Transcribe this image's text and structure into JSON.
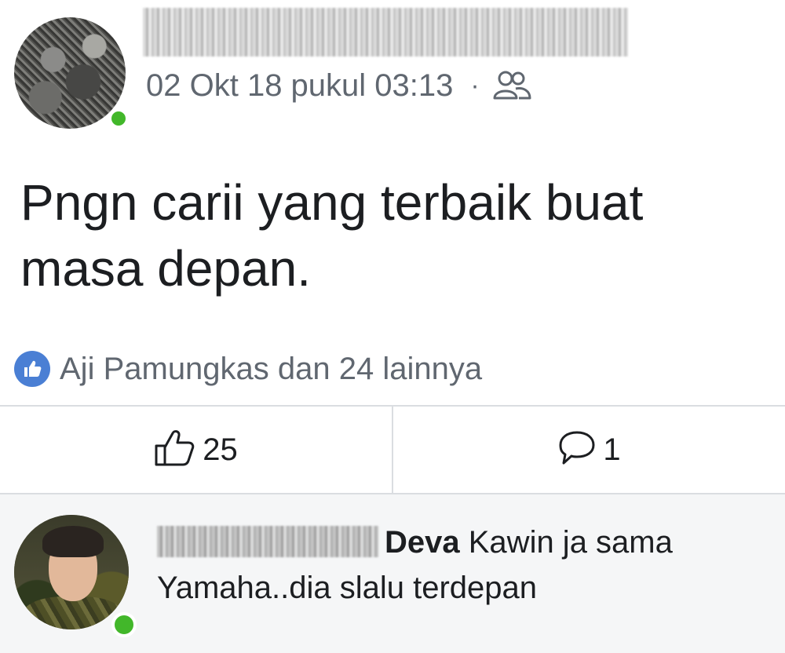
{
  "post": {
    "author_name": "",
    "timestamp": "02 Okt 18 pukul 03:13",
    "separator": "·",
    "audience_icon": "friends-icon",
    "text": "Pngn carii yang terbaik buat masa depan."
  },
  "reactions": {
    "icon": "like-badge-icon",
    "summary": "Aji Pamungkas dan 24 lainnya"
  },
  "actions": {
    "like_count": "25",
    "comment_count": "1"
  },
  "comment": {
    "author_first_name": "Deva",
    "text": "Kawin ja sama Yamaha..dia slalu terdepan",
    "online": true
  },
  "colors": {
    "online_green": "#42b72a",
    "like_blue": "#4a7fd4",
    "meta_gray": "#606770",
    "comment_bg": "#f5f6f7"
  }
}
